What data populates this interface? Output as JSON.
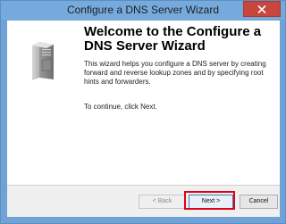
{
  "window": {
    "title": "Configure a DNS Server Wizard"
  },
  "icons": {
    "close": "close-icon",
    "server": "server-icon"
  },
  "wizard": {
    "heading": "Welcome to the Configure a DNS Server Wizard",
    "description": "This wizard helps you configure a DNS server by creating forward and reverse lookup zones and by specifying root hints and forwarders.",
    "instruction": "To continue, click Next."
  },
  "buttons": {
    "back": "< Back",
    "next": "Next >",
    "cancel": "Cancel"
  },
  "colors": {
    "titlebar": "#76aadd",
    "close_button": "#c9463d",
    "highlight": "#e0001b"
  }
}
